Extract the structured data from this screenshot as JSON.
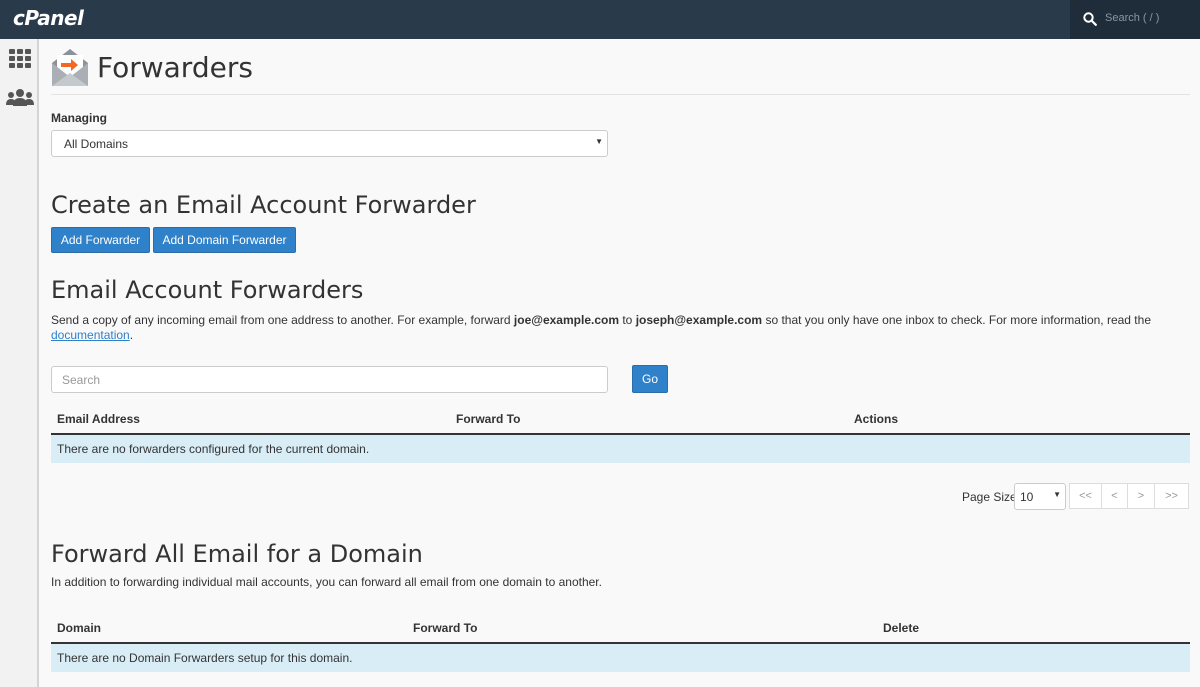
{
  "app": {
    "logo": "cPanel",
    "search_placeholder": "Search ( / )"
  },
  "icons": {
    "search": "search-icon",
    "apps": "grid-icon",
    "users": "users-icon",
    "page": "envelope-forward-icon"
  },
  "page": {
    "title": "Forwarders"
  },
  "managing": {
    "label": "Managing",
    "value": "All Domains"
  },
  "create": {
    "heading": "Create an Email Account Forwarder",
    "add_forwarder": "Add Forwarder",
    "add_domain_forwarder": "Add Domain Forwarder"
  },
  "email_forwarders": {
    "heading": "Email Account Forwarders",
    "desc_1": "Send a copy of any incoming email from one address to another. For example, forward ",
    "desc_bold_1": "joe@example.com",
    "desc_2": " to ",
    "desc_bold_2": "joseph@example.com",
    "desc_3": " so that you only have one inbox to check. For more information, read the",
    "desc_link": "documentation",
    "desc_end": ".",
    "search_placeholder": "Search",
    "go": "Go",
    "columns": [
      "Email Address",
      "Forward To",
      "Actions"
    ],
    "empty": "There are no forwarders configured for the current domain.",
    "page_size_label": "Page Size",
    "page_size": "10",
    "pager": [
      "<<",
      "<",
      ">",
      ">>"
    ]
  },
  "domain_forwarders": {
    "heading": "Forward All Email for a Domain",
    "desc": "In addition to forwarding individual mail accounts, you can forward all email from one domain to another.",
    "columns": [
      "Domain",
      "Forward To",
      "Delete"
    ],
    "empty": "There are no Domain Forwarders setup for this domain."
  },
  "colors": {
    "topbar": "#293a4a",
    "primary": "#2f81c9",
    "info_row": "#d9edf7"
  }
}
